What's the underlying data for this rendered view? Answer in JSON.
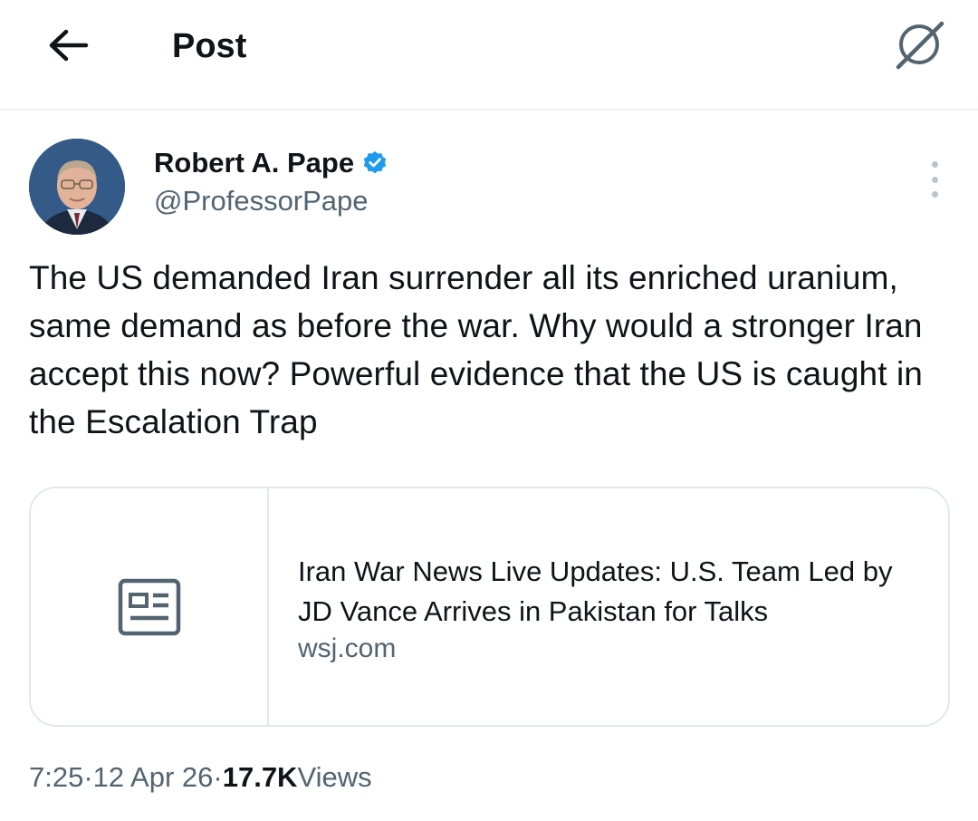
{
  "header": {
    "title": "Post",
    "back_icon": "arrow-left-icon",
    "grok_icon": "grok-icon"
  },
  "author": {
    "name": "Robert A. Pape",
    "handle": "@ProfessorPape",
    "verified_color": "#1d9bf0"
  },
  "tweet": {
    "text": "The US demanded Iran surrender all its enriched uranium, same demand as before the war. Why would a stronger Iran accept this now?  Powerful evidence that the US is caught in the Escalation Trap"
  },
  "link_card": {
    "icon": "article-icon",
    "title": "Iran War News Live Updates: U.S. Team Led by JD Vance Arrives in Pakistan for Talks",
    "domain": "wsj.com"
  },
  "meta": {
    "time": "7:25",
    "date": "12 Apr 26",
    "separator": " · ",
    "views_count": "17.7K",
    "views_label": " Views"
  },
  "colors": {
    "text": "#0f1419",
    "secondary": "#536471",
    "border": "#e3e8eb"
  }
}
